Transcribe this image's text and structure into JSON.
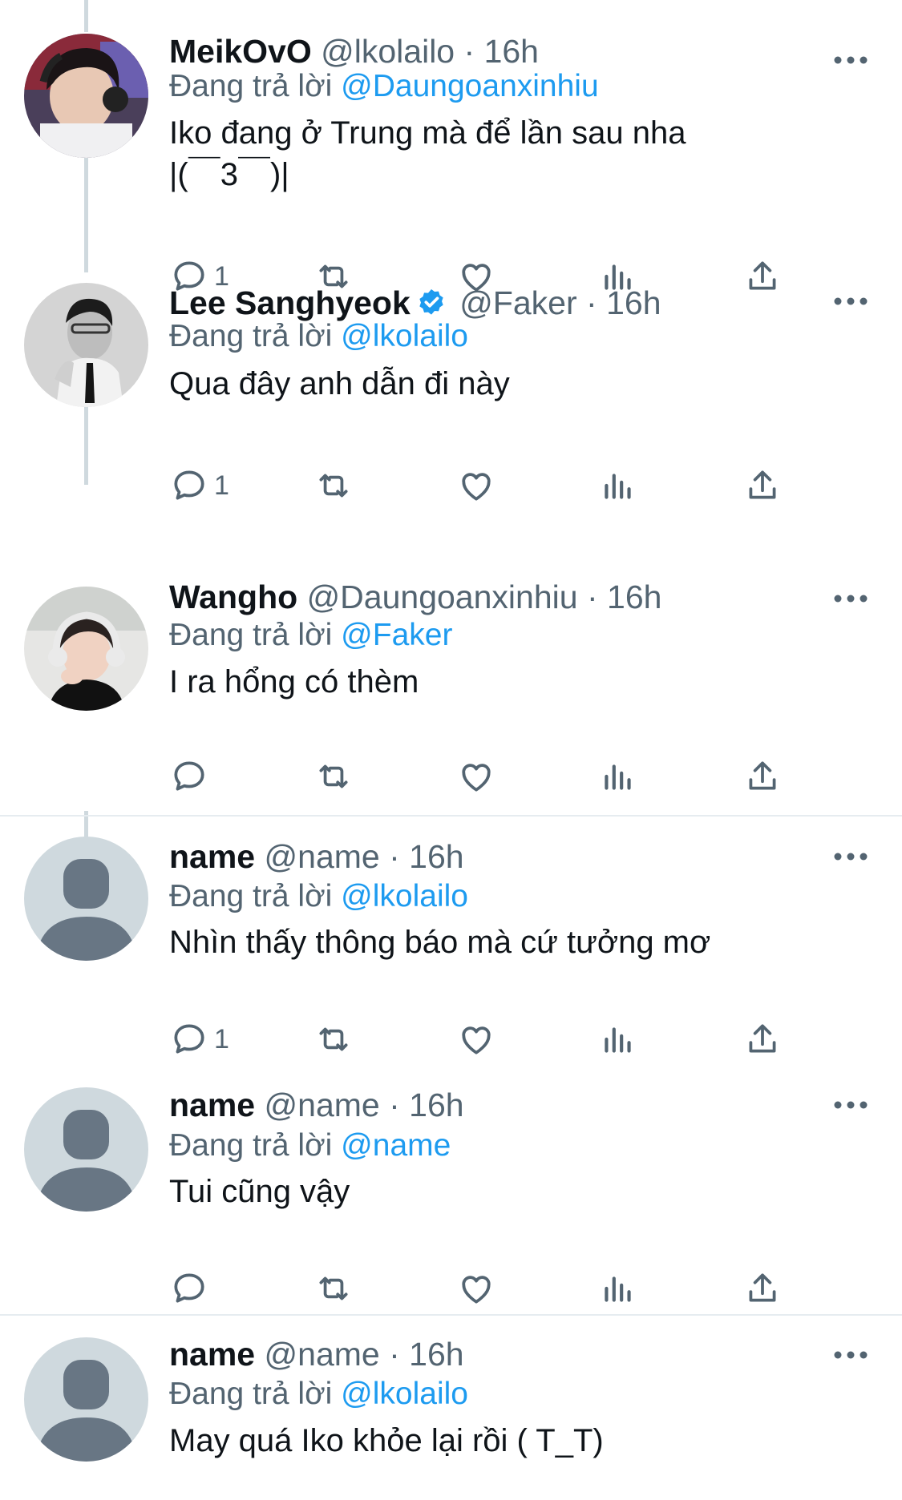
{
  "tweets": [
    {
      "name": "MeikOvO",
      "handle": "@lkolailo",
      "time": "16h",
      "verified": false,
      "replying_label": "Đang trả lời",
      "replying_to": "@Daungoanxinhiu",
      "text_lines": [
        "Iko đang ở Trung mà để lần sau nha",
        "|(￣3￣)|"
      ],
      "reply_count": "1",
      "avatar": "photo-gamer-headset"
    },
    {
      "name": "Lee Sanghyeok",
      "handle": "@Faker",
      "time": "16h",
      "verified": true,
      "replying_label": "Đang trả lời",
      "replying_to": "@lkolailo",
      "text_lines": [
        "Qua đây anh dẫn đi này"
      ],
      "reply_count": "1",
      "avatar": "photo-man-suit"
    },
    {
      "name": "Wangho",
      "handle": "@Daungoanxinhiu",
      "time": "16h",
      "verified": false,
      "replying_label": "Đang trả lời",
      "replying_to": "@Faker",
      "text_lines": [
        "I ra hổng có thèm"
      ],
      "reply_count": "",
      "avatar": "photo-headphones"
    },
    {
      "name": "name",
      "handle": "@name",
      "time": "16h",
      "verified": false,
      "replying_label": "Đang trả lời",
      "replying_to": "@lkolailo",
      "text_lines": [
        "Nhìn thấy thông báo mà cứ tưởng mơ"
      ],
      "reply_count": "1",
      "avatar": "default-avatar"
    },
    {
      "name": "name",
      "handle": "@name",
      "time": "16h",
      "verified": false,
      "replying_label": "Đang trả lời",
      "replying_to": "@name",
      "text_lines": [
        "Tui cũng vậy"
      ],
      "reply_count": "",
      "avatar": "default-avatar"
    },
    {
      "name": "name",
      "handle": "@name",
      "time": "16h",
      "verified": false,
      "replying_label": "Đang trả lời",
      "replying_to": "@lkolailo",
      "text_lines": [
        "May quá Iko khỏe lại rồi ( T_T)"
      ],
      "reply_count": "",
      "avatar": "default-avatar"
    }
  ],
  "icons": {
    "reply": "reply-icon",
    "retweet": "retweet-icon",
    "like": "like-icon",
    "views": "views-icon",
    "share": "share-icon",
    "more": "more-icon",
    "verified": "verified-badge-icon"
  },
  "colors": {
    "accent": "#1d9bf0",
    "secondary_text": "#536471",
    "thread_line": "#cfd9de",
    "default_avatar_bg": "#cfd9de",
    "default_avatar_fg": "#687684"
  }
}
